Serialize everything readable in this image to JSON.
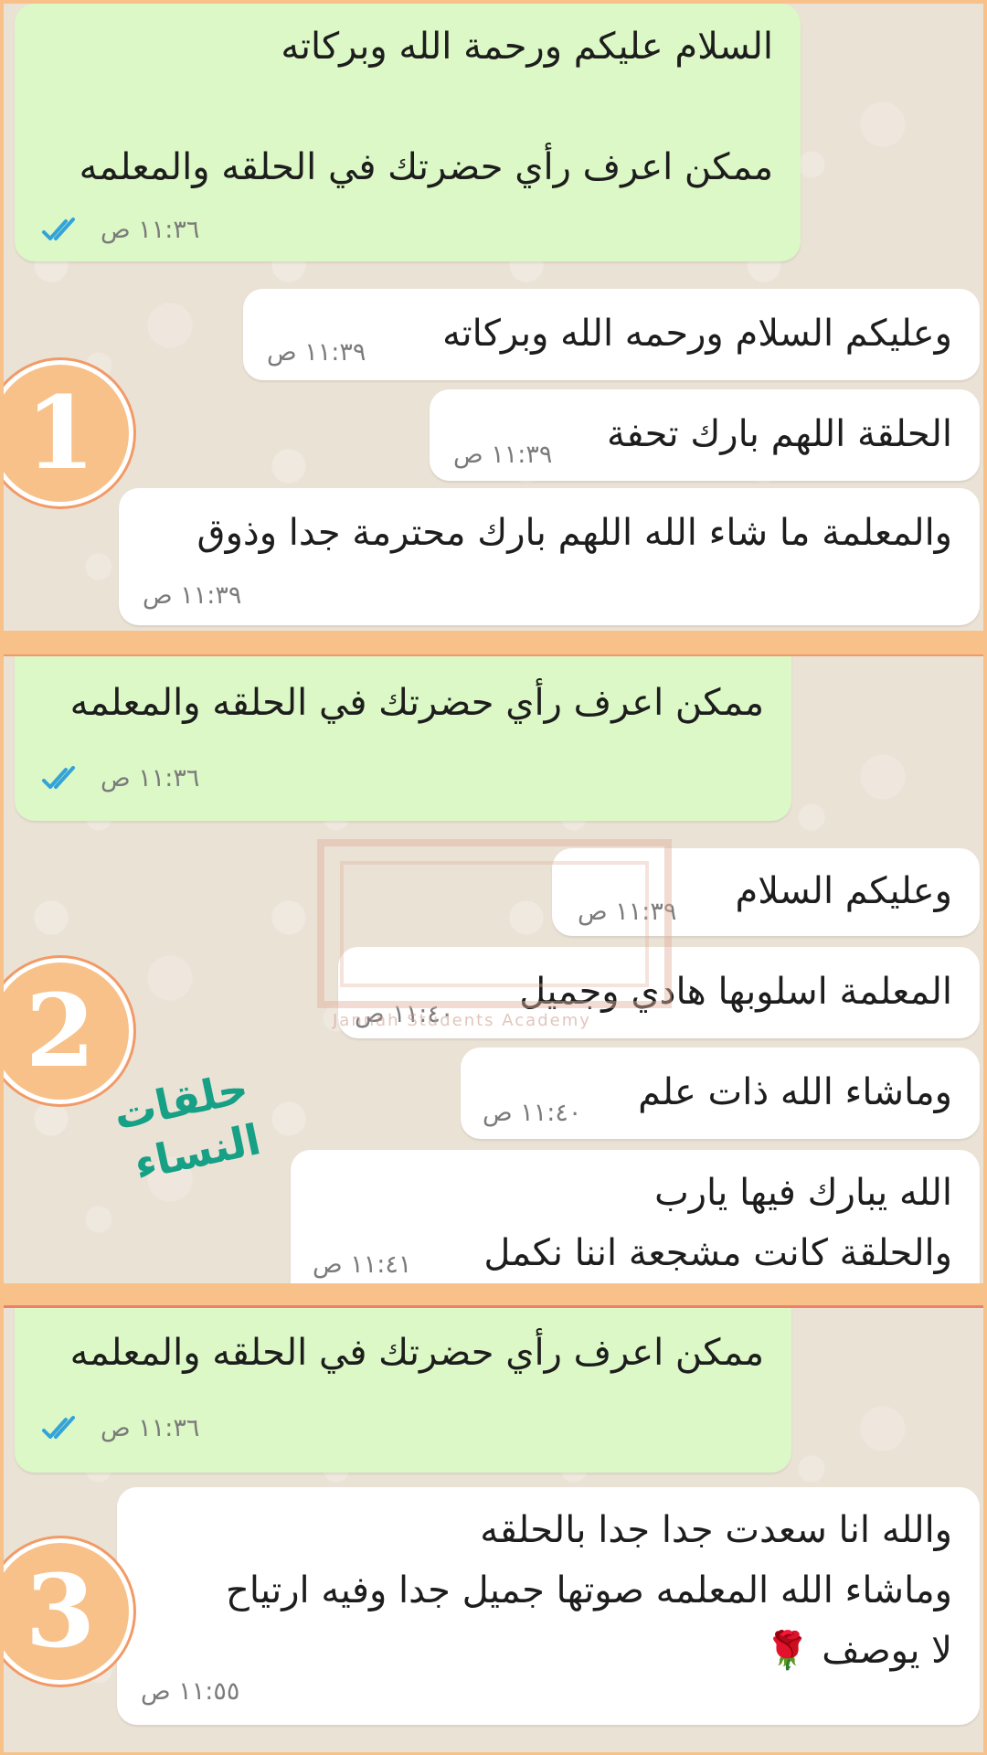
{
  "colors": {
    "frame": "#f7c189",
    "divider_1": "#f29a65",
    "divider_2": "#f07f6a",
    "outgoing_bubble": "#dcf8c6",
    "incoming_bubble": "#ffffff",
    "read_ticks": "#34a3d8",
    "stamp_green": "#16a085"
  },
  "panel1": {
    "badge": "1",
    "messages": [
      {
        "text": "السلام عليكم ورحمة الله وبركاته\n\nممكن اعرف رأي حضرتك في الحلقه والمعلمه",
        "time": "١١:٣٦ ص",
        "status_icon": "double-check-icon"
      },
      {
        "text": "وعليكم السلام ورحمه الله وبركاته",
        "time": "١١:٣٩ ص"
      },
      {
        "text": "الحلقة اللهم بارك تحفة",
        "time": "١١:٣٩ ص"
      },
      {
        "text": "والمعلمة ما شاء الله اللهم بارك محترمة جدا وذوق",
        "time": "١١:٣٩ ص"
      }
    ]
  },
  "panel2": {
    "badge": "2",
    "stamp_text": "حلقات النساء",
    "watermark_caption": "Jannah Students Academy",
    "messages": [
      {
        "text": "ممكن اعرف رأي حضرتك في الحلقه والمعلمه",
        "time": "١١:٣٦ ص",
        "status_icon": "double-check-icon"
      },
      {
        "text": "وعليكم السلام",
        "time": "١١:٣٩ ص"
      },
      {
        "text": "المعلمة اسلوبها هادي وجميل",
        "time": "١١:٤٠ ص"
      },
      {
        "text": "وماشاء الله ذات علم",
        "time": "١١:٤٠ ص"
      },
      {
        "text": "الله يبارك فيها يارب\nوالحلقة كانت مشجعة اننا نكمل",
        "time": "١١:٤١ ص"
      }
    ]
  },
  "panel3": {
    "badge": "3",
    "messages": [
      {
        "text": "ممكن اعرف رأي حضرتك في الحلقه والمعلمه",
        "time": "١١:٣٦ ص",
        "status_icon": "double-check-icon"
      },
      {
        "text": "والله انا سعدت جدا جدا بالحلقه\nوماشاء الله المعلمه صوتها جميل جدا وفيه ارتياح\nلا يوصف 🌹",
        "time": "١١:٥٥ ص"
      }
    ]
  }
}
